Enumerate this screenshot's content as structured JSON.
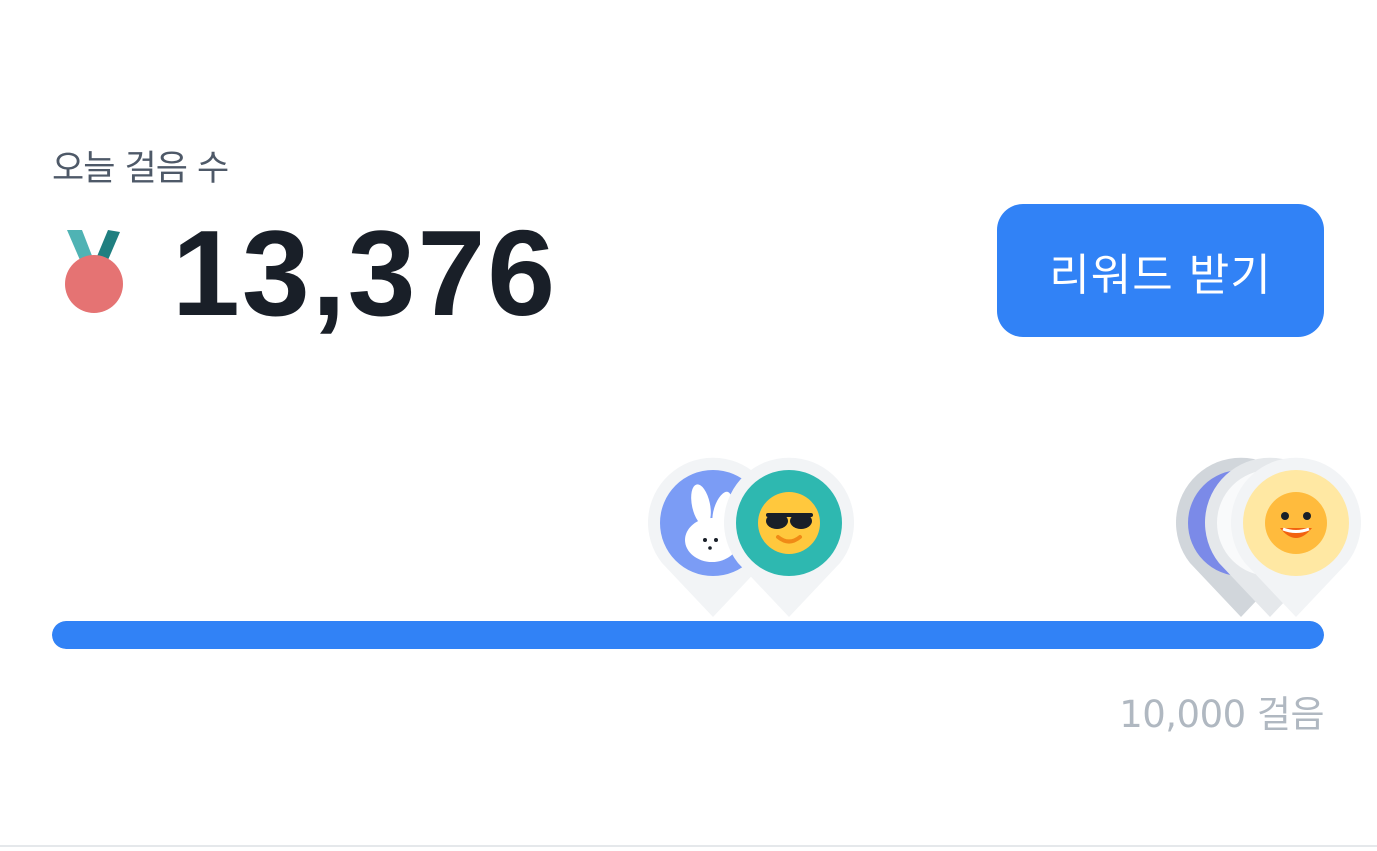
{
  "steps": {
    "label": "오늘 걸음 수",
    "count": "13,376",
    "medal_icon": "medal-icon"
  },
  "reward_button": {
    "label": "리워드 받기"
  },
  "progress": {
    "fraction": 1.0,
    "goal_label": "10,000 걸음"
  },
  "pins": [
    {
      "icon": "rabbit-icon",
      "name": "rabbit-pin"
    },
    {
      "icon": "sunglasses-smiley-icon",
      "name": "sunglasses-pin"
    },
    {
      "icon": "purple-avatar-icon",
      "name": "purple-pin"
    },
    {
      "icon": "white-avatar-icon",
      "name": "white-pin"
    },
    {
      "icon": "smiley-icon",
      "name": "smiley-pin"
    }
  ],
  "colors": {
    "accent": "#3182f6",
    "text_primary": "#191f28",
    "text_secondary": "#4e5968",
    "text_muted": "#b0b8c1"
  }
}
